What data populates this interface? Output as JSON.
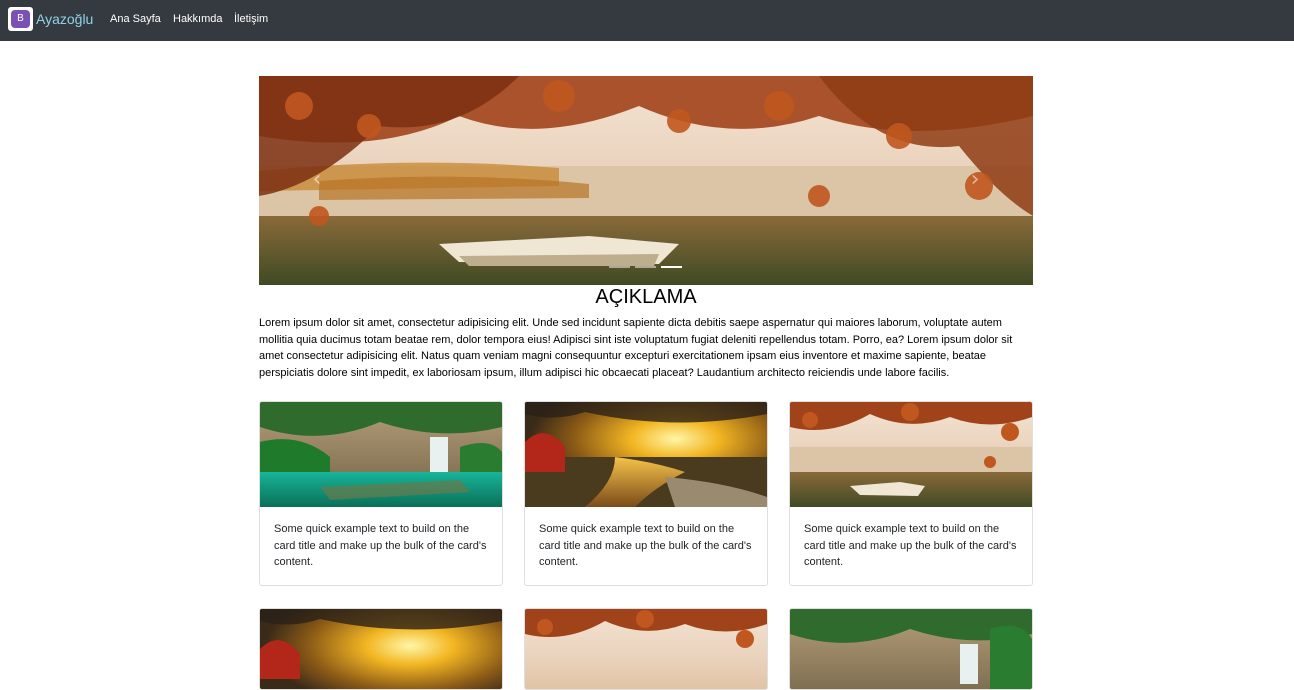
{
  "navbar": {
    "brand_logo_letter": "B",
    "brand": "Ayazoğlu",
    "links": [
      "Ana Sayfa",
      "Hakkımda",
      "İletişim"
    ]
  },
  "carousel": {
    "prev_icon": "chevron-left-icon",
    "next_icon": "chevron-right-icon",
    "slide_count": 3,
    "active_slide": 3
  },
  "main": {
    "heading": "AÇIKLAMA",
    "description": "Lorem ipsum dolor sit amet, consectetur adipisicing elit. Unde sed incidunt sapiente dicta debitis saepe aspernatur qui maiores laborum, voluptate autem mollitia quia ducimus totam beatae rem, dolor tempora eius! Adipisci sint iste voluptatum fugiat deleniti repellendus totam. Porro, ea? Lorem ipsum dolor sit amet consectetur adipisicing elit. Natus quam veniam magni consequuntur excepturi exercitationem ipsam eius inventore et maxime sapiente, beatae perspiciatis dolore sint impedit, ex laboriosam ipsum, illum adipisci hic obcaecati placeat? Laudantium architecto reiciendis unde labore facilis."
  },
  "cards": [
    {
      "image": "waterfall-lake",
      "text": "Some quick example text to build on the card title and make up the bulk of the card's content."
    },
    {
      "image": "sunset-river",
      "text": "Some quick example text to build on the card title and make up the bulk of the card's content."
    },
    {
      "image": "autumn-lake-boat",
      "text": "Some quick example text to build on the card title and make up the bulk of the card's content."
    },
    {
      "image": "sunset-river"
    },
    {
      "image": "autumn-lake-boat"
    },
    {
      "image": "waterfall-lake"
    }
  ],
  "colors": {
    "navbar_bg": "#343a40",
    "brand_text": "#8fd3ea",
    "brand_logo": "#7952b3"
  }
}
